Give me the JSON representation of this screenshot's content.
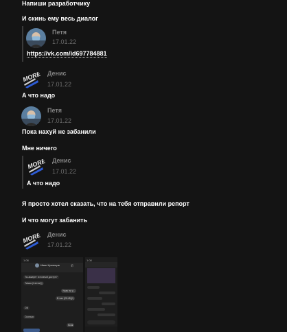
{
  "messages": {
    "m1": "Напиши разработчику",
    "m2": "И скинь ему весь диалог",
    "fwd1_author": "Петя",
    "fwd1_date": "17.01.22",
    "fwd1_link": "https://vk.com/id697784881",
    "denis1_author": "Денис",
    "denis1_date": "17.01.22",
    "m3": "А что надо",
    "petya2_author": "Петя",
    "petya2_date": "17.01.22",
    "m4": "Пока нахуй не забанили",
    "m5": "Мне ничего",
    "fwd2_author": "Денис",
    "fwd2_date": "17.01.22",
    "fwd2_text": "А что надо",
    "m6": "Я просто хотел сказать, что на тебя отправили репорт",
    "m7": "И что могут забанить",
    "denis3_author": "Денис",
    "denis3_date": "17.01.22"
  },
  "screenshot_left": {
    "time": "1:08",
    "name": "Иван Кузнецов",
    "b1": "Ты аккаунт в полный доступ?",
    "b2": "Тимка (Санта(!))",
    "b3": "Ужас ни у...",
    "b4": "В час (20:45)(!)",
    "b5": "Ой",
    "b6": "Сколько",
    "b7": "Ксак"
  },
  "screenshot_right": {
    "time": "1:08"
  },
  "colors": {
    "background": "#141414",
    "text": "#ffffff",
    "author": "#828282",
    "date": "#6d6d6d"
  }
}
